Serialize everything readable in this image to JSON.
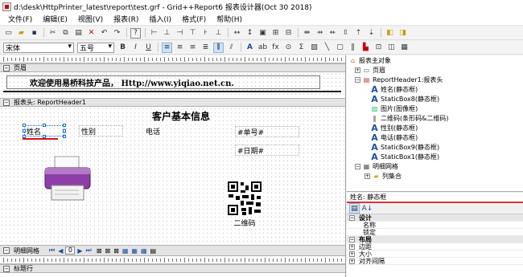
{
  "window": {
    "title": "d:\\desk\\HttpPrinter_latest\\report\\test.grf - Grid++Report6 报表设计器(Oct 30 2018)"
  },
  "menu": [
    "文件(F)",
    "编辑(E)",
    "视图(V)",
    "报表(R)",
    "插入(I)",
    "格式(F)",
    "帮助(H)"
  ],
  "toolbar": {
    "font": "宋体",
    "size": "五号",
    "bold": "B",
    "italic": "I",
    "underline": "U"
  },
  "sections": {
    "page_header": "页眉",
    "report_header": "报表头: ReportHeader1",
    "detail": "明细网格",
    "column_header": "标题行"
  },
  "page_header": {
    "banner": "欢迎使用易桥科技产品， Http://www.yiqiao.net.cn."
  },
  "report": {
    "title": "客户基本信息",
    "name": "姓名",
    "gender": "性别",
    "phone": "电话",
    "order_no": "#单号#",
    "date": "#日期#",
    "qr_label": "二维码"
  },
  "detail_toolbar": {
    "page": "0"
  },
  "tree": {
    "root": "报表主对象",
    "items": [
      {
        "label": "页眉",
        "level": 1,
        "exp": "+",
        "icon": "page-icon"
      },
      {
        "label": "ReportHeader1:报表头",
        "level": 1,
        "exp": "−",
        "icon": "section-icon"
      },
      {
        "label": "姓名(静态框)",
        "level": 2,
        "icon": "A"
      },
      {
        "label": "StaticBox8(静态框)",
        "level": 2,
        "icon": "A"
      },
      {
        "label": "图片(图像框)",
        "level": 2,
        "icon": "img"
      },
      {
        "label": "二维码(条形码&二维码)",
        "level": 2,
        "icon": "bar"
      },
      {
        "label": "性别(静态框)",
        "level": 2,
        "icon": "A"
      },
      {
        "label": "电话(静态框)",
        "level": 2,
        "icon": "A"
      },
      {
        "label": "StaticBox9(静态框)",
        "level": 2,
        "icon": "A"
      },
      {
        "label": "StaticBox1(静态框)",
        "level": 2,
        "icon": "A"
      },
      {
        "label": "明细网格",
        "level": 1,
        "exp": "−",
        "icon": "grid"
      },
      {
        "label": "列集合",
        "level": 2,
        "exp": "+",
        "icon": "folder"
      }
    ]
  },
  "props": {
    "header": "姓名: 静态框",
    "rows": [
      {
        "label": "设计",
        "cat": true,
        "exp": "−"
      },
      {
        "label": "名称",
        "cat": false
      },
      {
        "label": "锁定",
        "cat": false
      },
      {
        "label": "布局",
        "cat": true,
        "exp": "−"
      },
      {
        "label": "边距",
        "cat": false,
        "exp": "+"
      },
      {
        "label": "大小",
        "cat": false,
        "exp": "+"
      },
      {
        "label": "对齐间隔",
        "cat": false,
        "exp": "+"
      }
    ]
  }
}
